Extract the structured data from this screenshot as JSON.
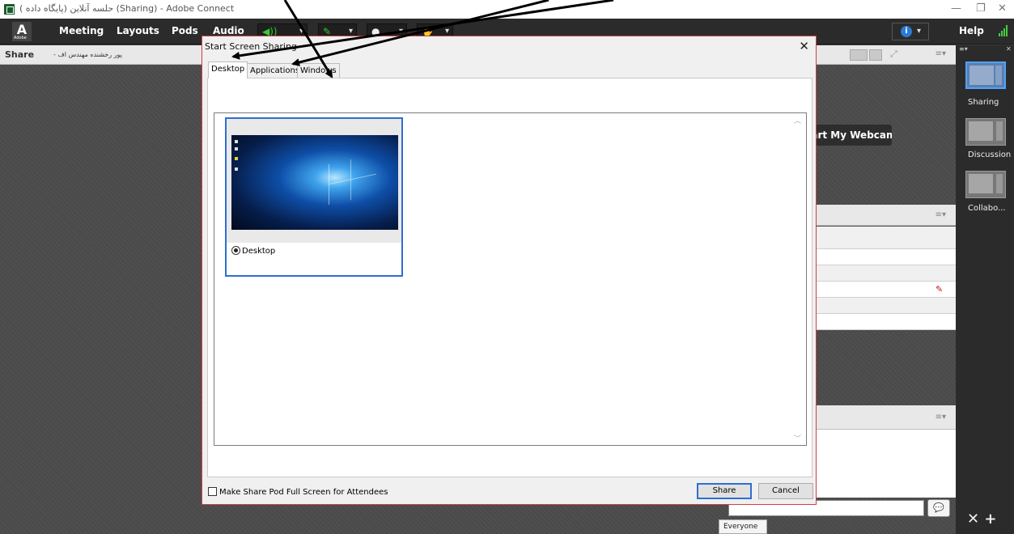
{
  "window": {
    "title": "حلسه آنلاین (پایگاه داده ) (Sharing) - Adobe Connect",
    "minimize": "—",
    "maximize": "❐",
    "close": "✕"
  },
  "menubar": {
    "logo_text": "Adobe",
    "items": [
      "Meeting",
      "Layouts",
      "Pods",
      "Audio"
    ],
    "help": "Help"
  },
  "share_pod": {
    "title": "Share",
    "subtitle": "- پور رخشنده مهندس اف"
  },
  "webcam": {
    "label": "Start My Webcam"
  },
  "chat": {
    "recipient_tab": "Everyone",
    "send_icon": "speech-bubble-icon"
  },
  "layouts": {
    "items": [
      {
        "label": "Sharing",
        "active": true
      },
      {
        "label": "Discussion",
        "active": false
      },
      {
        "label": "Collabo...",
        "active": false
      }
    ],
    "tools": "✕  +"
  },
  "dialog": {
    "title": "Start Screen Sharing",
    "tabs": [
      "Desktop",
      "Applications",
      "Windows"
    ],
    "selected_tab": "Desktop",
    "desktop_option": "Desktop",
    "fullscreen_checkbox": "Make Share Pod Full Screen for Attendees",
    "fullscreen_checked": false,
    "share_button": "Share",
    "cancel_button": "Cancel"
  },
  "colors": {
    "accent_blue": "#2f6ecf",
    "menubar_bg": "#2b2b2b",
    "dialog_border": "#d04040",
    "audio_green": "#33cc33"
  }
}
